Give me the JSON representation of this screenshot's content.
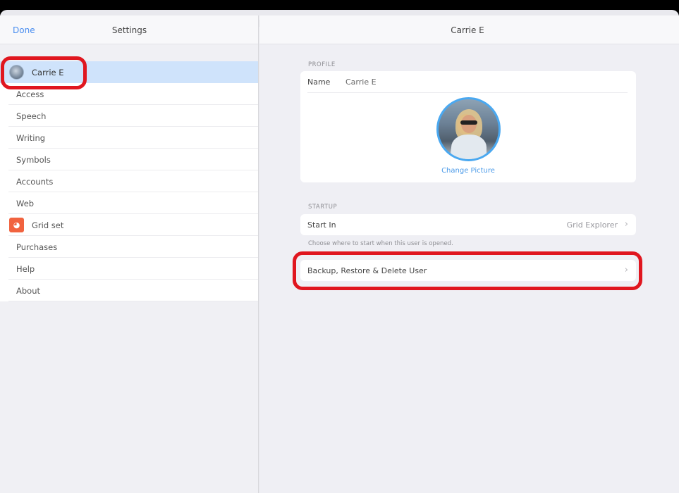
{
  "left_header": {
    "done_label": "Done",
    "title": "Settings"
  },
  "menu": {
    "selected_user": "Carrie E",
    "items": [
      {
        "label": "Access"
      },
      {
        "label": "Speech"
      },
      {
        "label": "Writing"
      },
      {
        "label": "Symbols"
      },
      {
        "label": "Accounts"
      },
      {
        "label": "Web"
      },
      {
        "label": "Grid set"
      },
      {
        "label": "Purchases"
      },
      {
        "label": "Help"
      },
      {
        "label": "About"
      }
    ]
  },
  "right_header": {
    "title": "Carrie E"
  },
  "profile": {
    "section_label": "PROFILE",
    "name_label": "Name",
    "name_value": "Carrie E",
    "change_picture": "Change Picture"
  },
  "startup": {
    "section_label": "STARTUP",
    "start_in_label": "Start In",
    "start_in_value": "Grid Explorer",
    "hint": "Choose where to start when this user is opened."
  },
  "backup": {
    "label": "Backup, Restore & Delete User"
  },
  "colors": {
    "accent": "#4a8ef0",
    "selected_row": "#cfe3fb",
    "highlight": "#e0161f",
    "gridset_icon": "#f1633f"
  }
}
